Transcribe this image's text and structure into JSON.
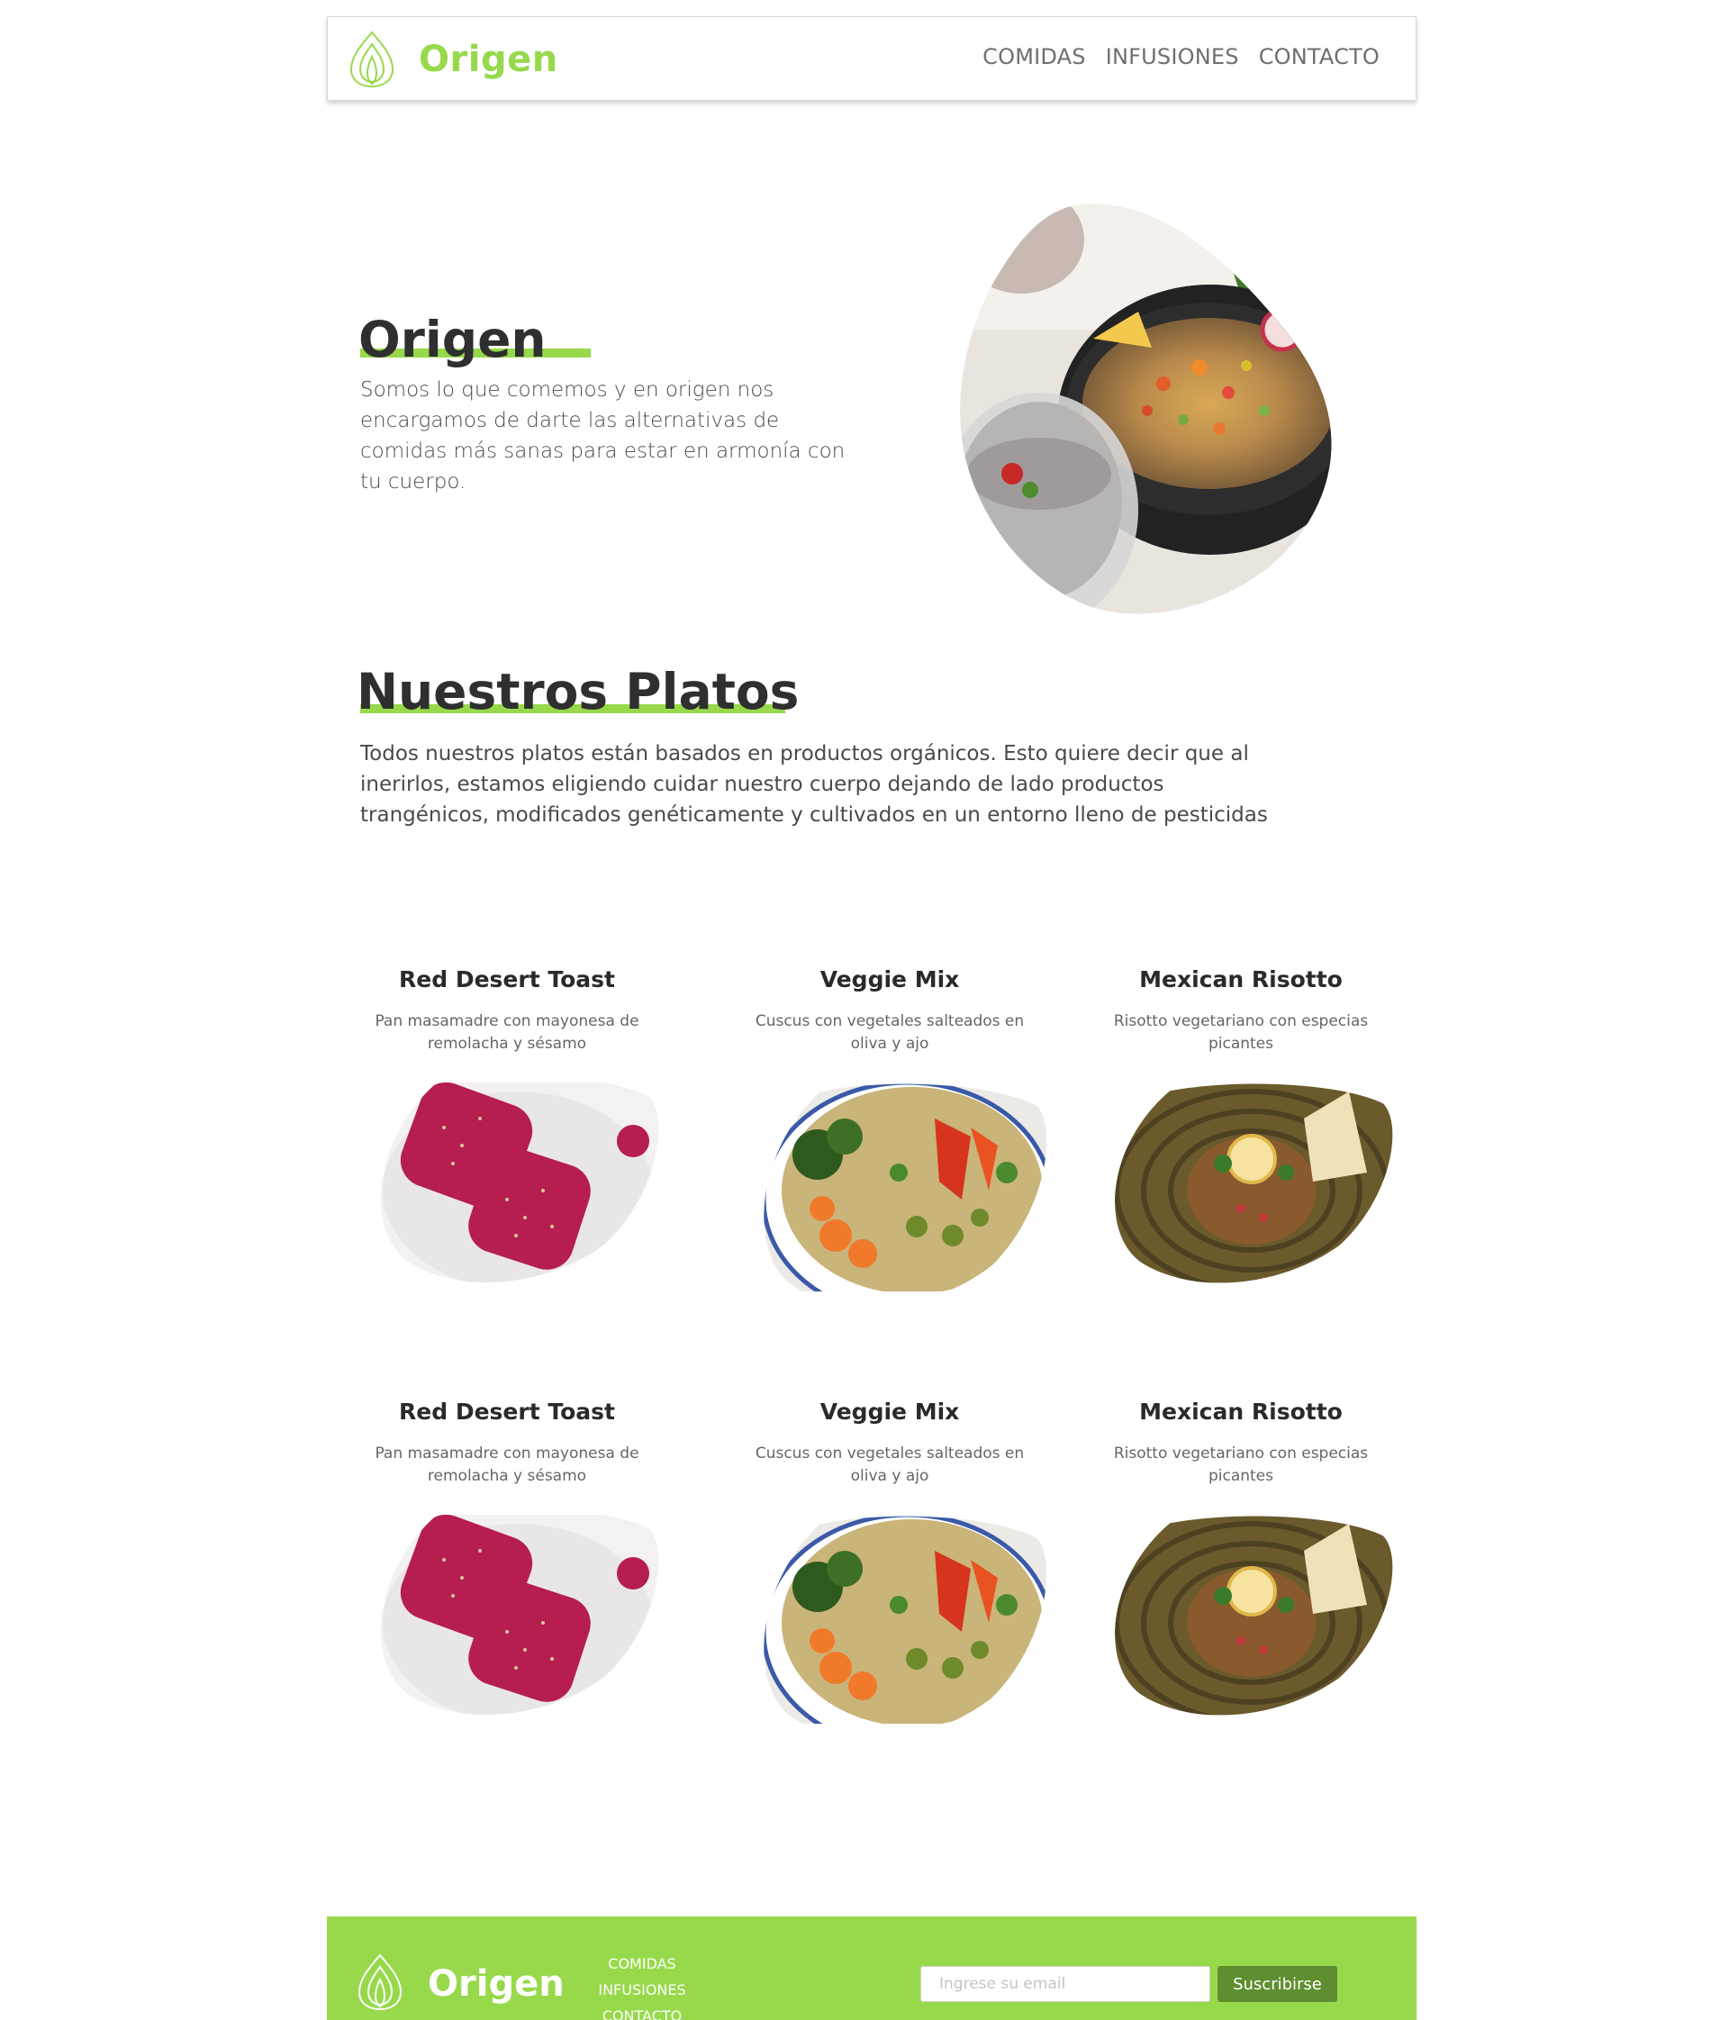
{
  "brand": {
    "name": "Origen"
  },
  "nav": {
    "items": [
      "COMIDAS",
      "INFUSIONES",
      "CONTACTO"
    ]
  },
  "hero": {
    "title": "Origen",
    "text": "Somos lo que comemos y en origen nos encargamos de darte las alternativas de comidas más sanas para estar en armonía con tu cuerpo."
  },
  "platos": {
    "title": "Nuestros Platos",
    "text": "Todos nuestros platos están basados en productos orgánicos. Esto quiere decir que al inerirlos, estamos eligiendo cuidar nuestro cuerpo dejando de lado productos trangénicos, modificados genéticamente y cultivados en un entorno lleno de pesticidas"
  },
  "cards": [
    {
      "title": "Red Desert Toast",
      "desc": "Pan masamadre con mayonesa de remolacha y sésamo"
    },
    {
      "title": "Veggie Mix",
      "desc": "Cuscus con vegetales salteados en oliva y ajo"
    },
    {
      "title": "Mexican Risotto",
      "desc": "Risotto vegetariano con especias picantes"
    },
    {
      "title": "Red Desert Toast",
      "desc": "Pan masamadre con mayonesa de remolacha y sésamo"
    },
    {
      "title": "Veggie Mix",
      "desc": "Cuscus con vegetales salteados en oliva y ajo"
    },
    {
      "title": "Mexican Risotto",
      "desc": "Risotto vegetariano con especias picantes"
    }
  ],
  "footer": {
    "nav": [
      "COMIDAS",
      "INFUSIONES",
      "CONTACTO"
    ],
    "email_placeholder": "Ingrese su email",
    "subscribe_label": "Suscribirse"
  },
  "colors": {
    "accent": "#97d94b",
    "button": "#5f8e30",
    "text": "#2f2f2f"
  }
}
